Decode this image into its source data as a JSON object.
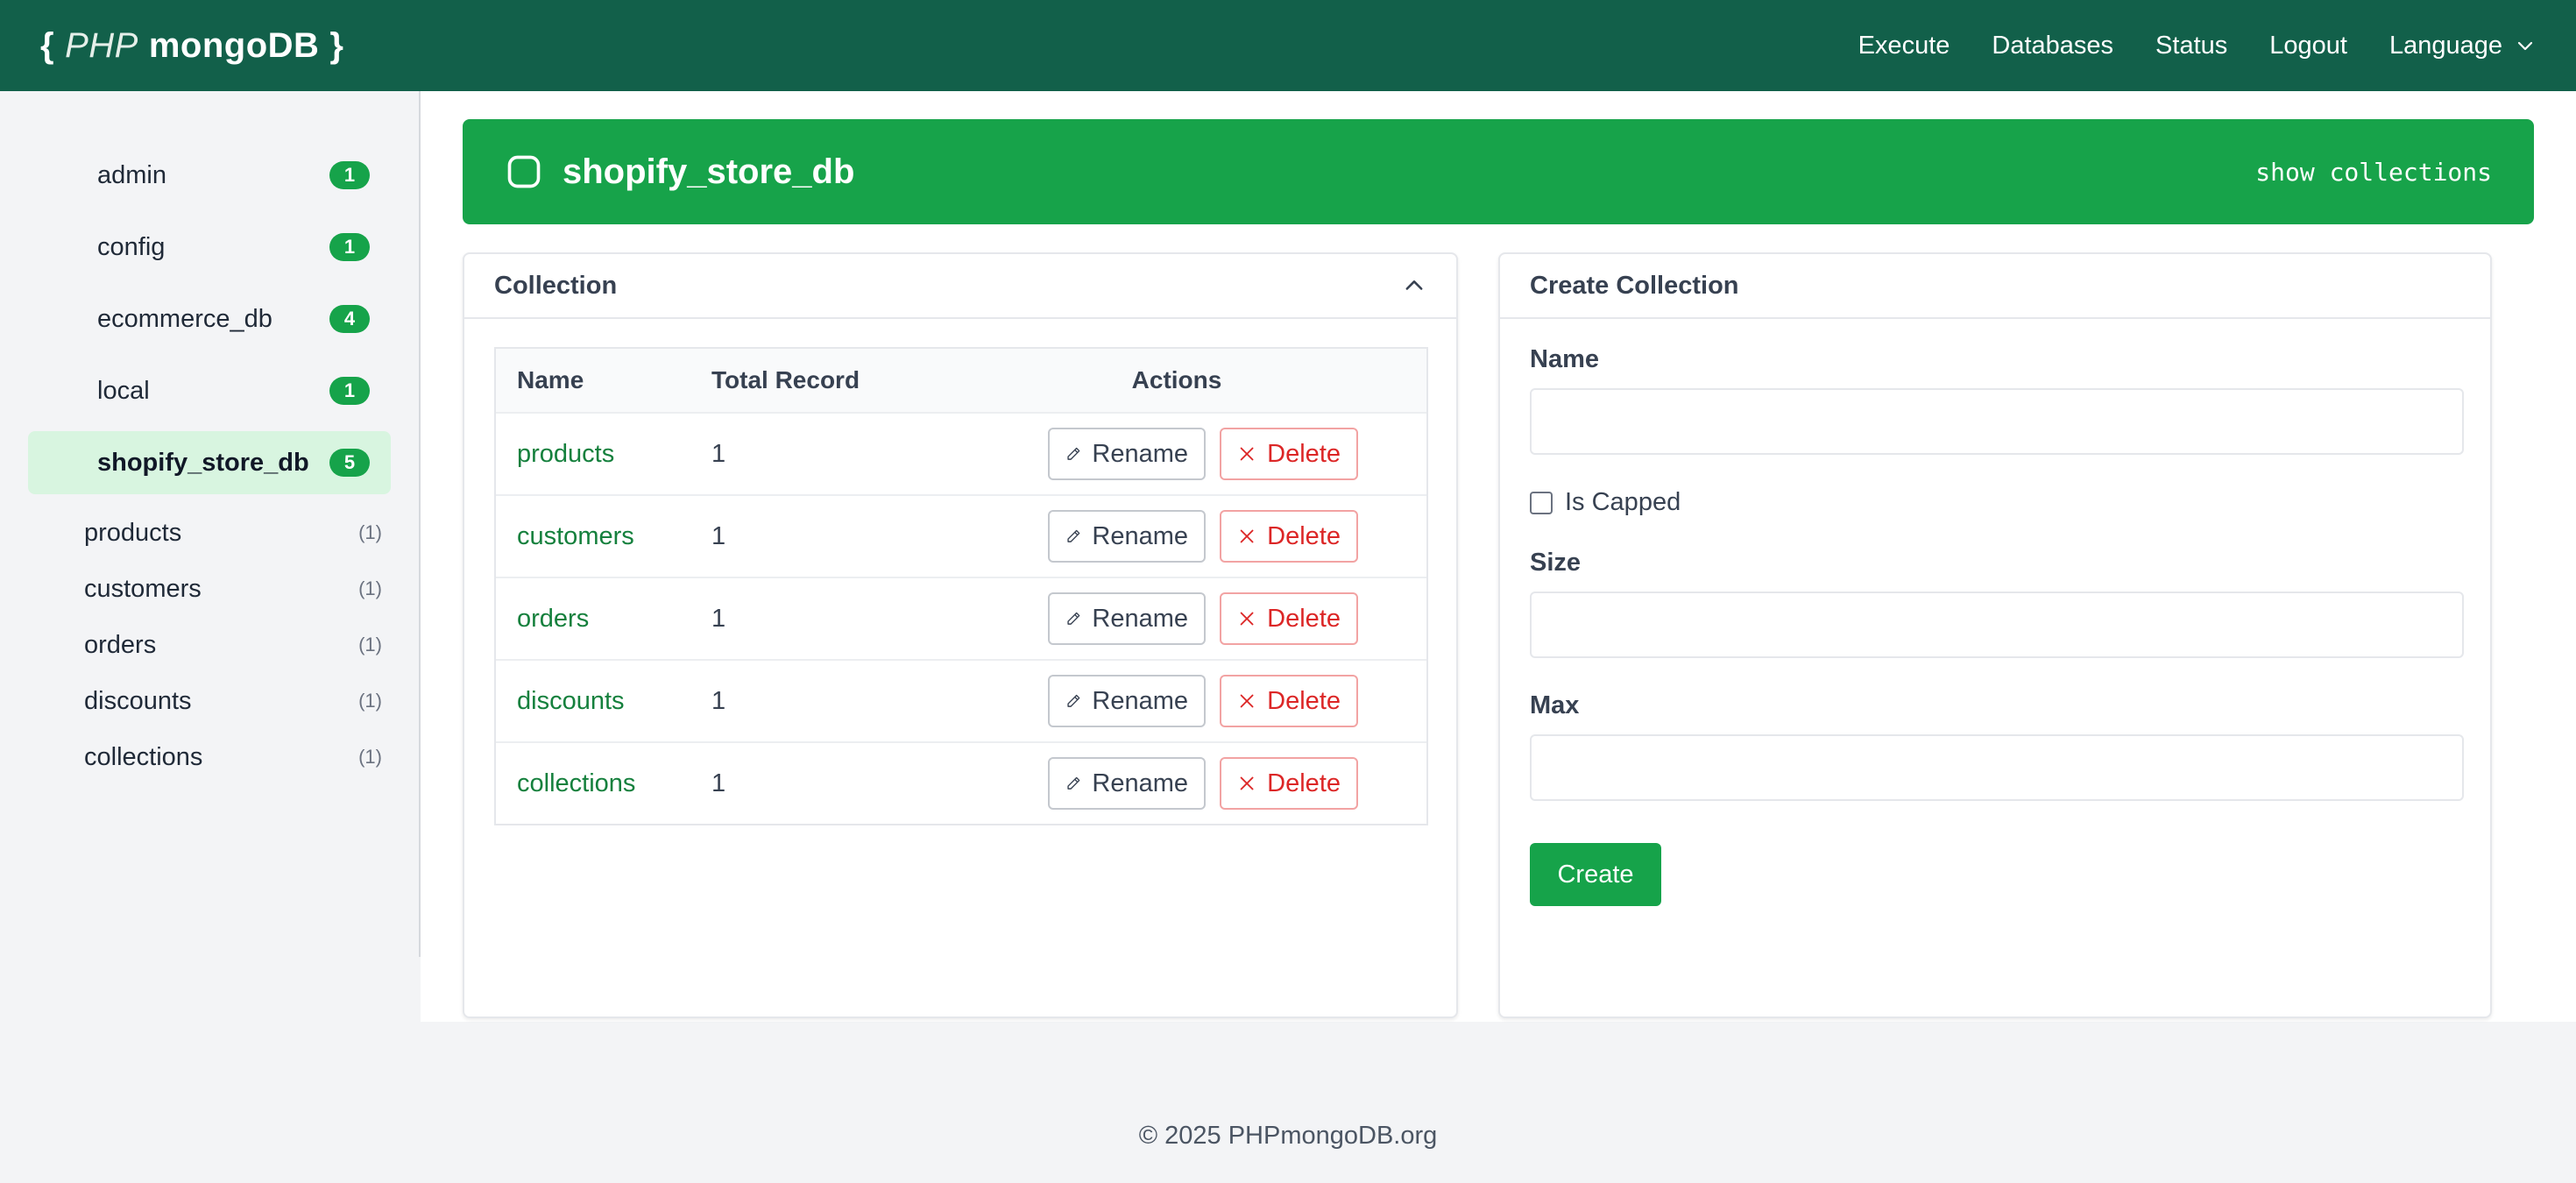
{
  "brand": {
    "open": "{",
    "php": "PHP",
    "name": "mongoDB",
    "close": "}"
  },
  "nav": [
    {
      "label": "Execute"
    },
    {
      "label": "Databases"
    },
    {
      "label": "Status"
    },
    {
      "label": "Logout"
    },
    {
      "label": "Language"
    }
  ],
  "sidebar": {
    "databases": [
      {
        "label": "admin",
        "count": "1"
      },
      {
        "label": "config",
        "count": "1"
      },
      {
        "label": "ecommerce_db",
        "count": "4"
      },
      {
        "label": "local",
        "count": "1"
      },
      {
        "label": "shopify_store_db",
        "count": "5",
        "active": true
      }
    ],
    "collections": [
      {
        "label": "products",
        "count": "(1)"
      },
      {
        "label": "customers",
        "count": "(1)"
      },
      {
        "label": "orders",
        "count": "(1)"
      },
      {
        "label": "discounts",
        "count": "(1)"
      },
      {
        "label": "collections",
        "count": "(1)"
      }
    ]
  },
  "banner": {
    "title": "shopify_store_db",
    "command": "show collections"
  },
  "collection_card": {
    "title": "Collection",
    "headers": {
      "name": "Name",
      "total": "Total Record",
      "actions": "Actions"
    },
    "rename_label": "Rename",
    "delete_label": "Delete",
    "rows": [
      {
        "name": "products",
        "total": "1"
      },
      {
        "name": "customers",
        "total": "1"
      },
      {
        "name": "orders",
        "total": "1"
      },
      {
        "name": "discounts",
        "total": "1"
      },
      {
        "name": "collections",
        "total": "1"
      }
    ]
  },
  "create_card": {
    "title": "Create Collection",
    "name_label": "Name",
    "capped_label": "Is Capped",
    "size_label": "Size",
    "max_label": "Max",
    "create_label": "Create"
  },
  "footer": {
    "text": "© 2025 PHPmongoDB.org"
  },
  "colors": {
    "navbar": "#12604a",
    "accent": "#17a34a",
    "danger": "#dc2626"
  }
}
